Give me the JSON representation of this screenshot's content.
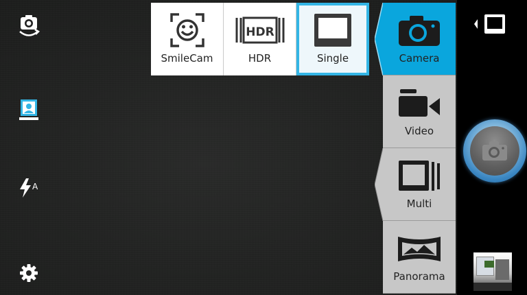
{
  "left_controls": [
    {
      "name": "switch-camera-icon"
    },
    {
      "name": "portrait-icon"
    },
    {
      "name": "flash-auto-icon",
      "badge": "A"
    },
    {
      "name": "settings-gear-icon"
    }
  ],
  "top_modes": [
    {
      "id": "smilecam",
      "label": "SmileCam",
      "icon": "smile-face-icon",
      "selected": false
    },
    {
      "id": "hdr",
      "label": "HDR",
      "icon": "hdr-icon",
      "icon_text": "HDR",
      "selected": false
    },
    {
      "id": "single",
      "label": "Single",
      "icon": "single-frame-icon",
      "selected": true
    }
  ],
  "side_modes": [
    {
      "id": "camera",
      "label": "Camera",
      "icon": "camera-icon",
      "active": true
    },
    {
      "id": "video",
      "label": "Video",
      "icon": "video-camera-icon",
      "active": false
    },
    {
      "id": "multi",
      "label": "Multi",
      "icon": "multi-frame-icon",
      "active": false
    },
    {
      "id": "panorama",
      "label": "Panorama",
      "icon": "panorama-icon",
      "active": false
    }
  ],
  "colors": {
    "accent": "#33b5e5",
    "active_tile": "#0aa6dd",
    "inactive_tile": "#c7c7c7"
  }
}
